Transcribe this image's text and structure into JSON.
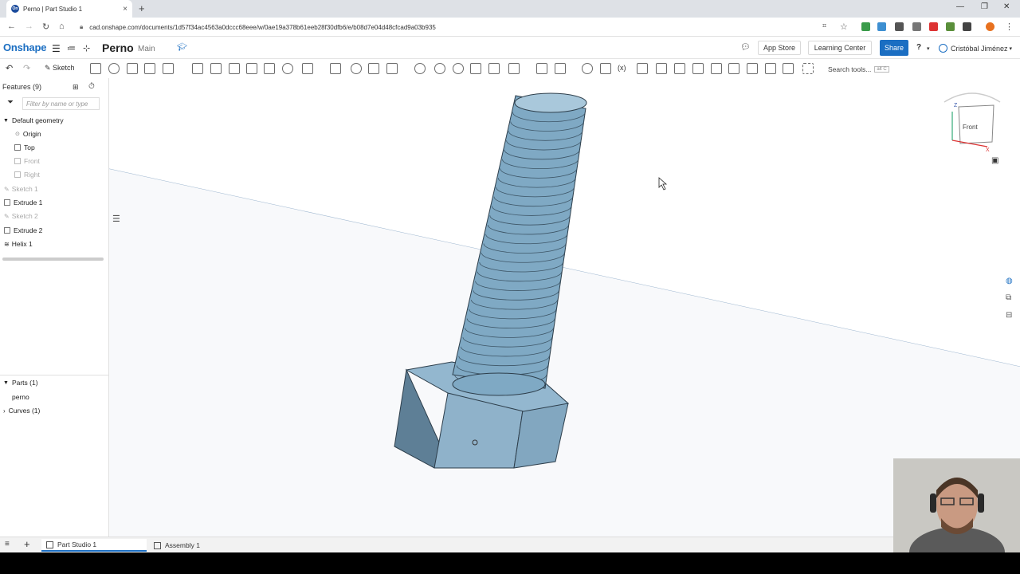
{
  "browser": {
    "tab_title": "Perno | Part Studio 1",
    "tab_favicon": "On",
    "url": "cad.onshape.com/documents/1d57f34ac4563a0dccc68eee/w/0ae19a378b61eeb28f30dfb6/e/b08d7e04d48cfcad9a03b935"
  },
  "header": {
    "logo": "Onshape",
    "doc_title": "Perno",
    "workspace": "Main",
    "app_store": "App Store",
    "learning_center": "Learning Center",
    "share": "Share",
    "help": "?",
    "user": "Cristóbal Jiménez",
    "accent": "#1b6ec2"
  },
  "toolbar": {
    "sketch_label": "Sketch",
    "search_label": "Search tools...",
    "search_shortcut": "alt C"
  },
  "features": {
    "header": "Features (9)",
    "filter_placeholder": "Filter by name or type",
    "default_geometry": "Default geometry",
    "items": [
      {
        "label": "Origin",
        "grey": false
      },
      {
        "label": "Top",
        "grey": false
      },
      {
        "label": "Front",
        "grey": true
      },
      {
        "label": "Right",
        "grey": true
      },
      {
        "label": "Sketch 1",
        "grey": true
      },
      {
        "label": "Extrude 1",
        "grey": false
      },
      {
        "label": "Sketch 2",
        "grey": true
      },
      {
        "label": "Extrude 2",
        "grey": false
      },
      {
        "label": "Helix 1",
        "grey": false
      }
    ]
  },
  "parts": {
    "header": "Parts (1)",
    "part_name": "perno",
    "curves": "Curves (1)"
  },
  "viewcube": {
    "face": "Front",
    "axis_z": "Z",
    "axis_x": "X"
  },
  "bottom_tabs": {
    "part_studio": "Part Studio 1",
    "assembly": "Assembly 1"
  },
  "model_color": "#7fa9c4"
}
